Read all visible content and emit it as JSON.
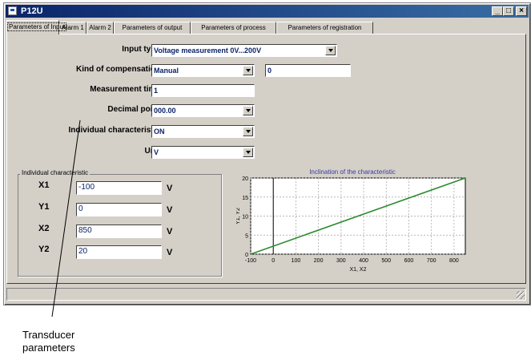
{
  "window": {
    "title": "P12U",
    "controls": {
      "minimize": "_",
      "maximize": "□",
      "close": "×"
    }
  },
  "tabs": [
    {
      "label": "Parameters of Input",
      "active": true
    },
    {
      "label": "Alarm 1",
      "active": false
    },
    {
      "label": "Alarm 2",
      "active": false
    },
    {
      "label": "Parameters of output",
      "active": false
    },
    {
      "label": "Parameters of process",
      "active": false
    },
    {
      "label": "Parameters of registration",
      "active": false
    }
  ],
  "form": {
    "input_type": {
      "label": "Input type",
      "value": "Voltage measurement 0V...200V"
    },
    "kind_of_compensation": {
      "label": "Kind of compensation",
      "value": "Manual",
      "extra_value": "0"
    },
    "measurement_time": {
      "label": "Measurement time",
      "value": "1"
    },
    "decimal_point": {
      "label": "Decimal point",
      "value": "000.00"
    },
    "individual_characteristic": {
      "label": "Individual characteristic",
      "value": "ON"
    },
    "unit": {
      "label": "Unit",
      "value": "V"
    }
  },
  "characteristic_group": {
    "title": "Individual characteristic",
    "rows": [
      {
        "name": "X1",
        "value": "-100",
        "unit": "V"
      },
      {
        "name": "Y1",
        "value": "0",
        "unit": "V"
      },
      {
        "name": "X2",
        "value": "850",
        "unit": "V"
      },
      {
        "name": "Y2",
        "value": "20",
        "unit": "V"
      }
    ]
  },
  "chart_data": {
    "type": "line",
    "title": "Inclination of the characteristic",
    "xlabel": "X1, X2",
    "ylabel": "Y1, Y2",
    "xlim": [
      -100,
      850
    ],
    "ylim": [
      0,
      20
    ],
    "x_ticks": [
      -100,
      0,
      100,
      200,
      300,
      400,
      500,
      600,
      700,
      800
    ],
    "y_ticks": [
      0,
      5,
      10,
      15,
      20
    ],
    "grid": true,
    "series": [
      {
        "x": [
          -100,
          850
        ],
        "y": [
          0,
          20
        ],
        "color": "#2e8b2e"
      }
    ]
  },
  "annotation": {
    "line1": "Transducer",
    "line2": "parameters"
  },
  "colors": {
    "titlebar_start": "#0a246a",
    "titlebar_end": "#3a6ea5",
    "window_face": "#d4d0c8",
    "field_text": "#0a246a",
    "series": "#2e8b2e"
  }
}
